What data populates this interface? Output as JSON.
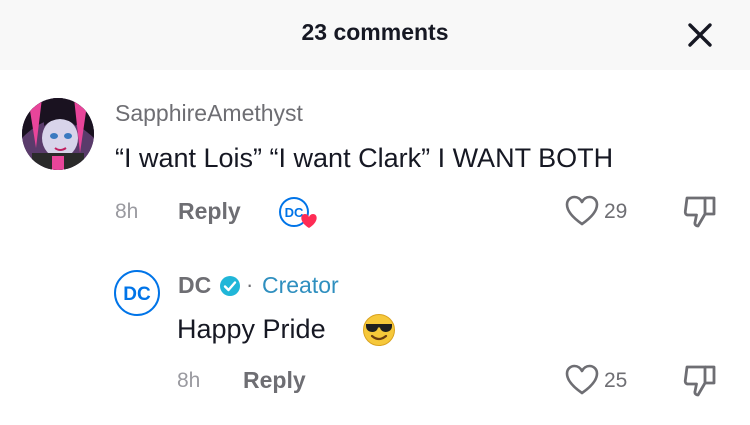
{
  "header": {
    "title": "23 comments"
  },
  "comments": [
    {
      "username": "SapphireAmethyst",
      "text": "“I want Lois” “I want Clark” I WANT BOTH",
      "time": "8h",
      "reply_label": "Reply",
      "likes": "29",
      "liked_by_creator": true
    },
    {
      "username": "DC",
      "creator_label": "Creator",
      "separator": "·",
      "text": "Happy Pride",
      "emoji": "smiling-face-with-sunglasses",
      "time": "8h",
      "reply_label": "Reply",
      "likes": "25",
      "verified": true,
      "avatar_text": "DC"
    }
  ],
  "colors": {
    "dc_blue": "#0074e8",
    "verified_blue": "#20d5ec",
    "heart_red": "#fe2c55",
    "creator_blue": "#2f8fbf"
  }
}
